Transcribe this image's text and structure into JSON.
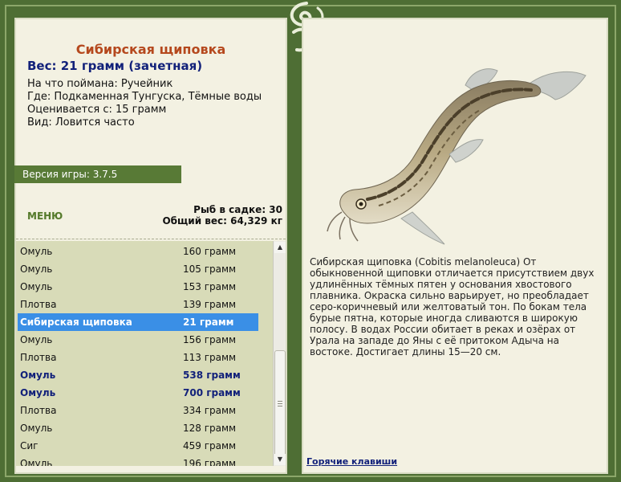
{
  "fish": {
    "name": "Сибирская щиповка",
    "weight_line": "Вес: 21 грамм (зачетная)",
    "bait_line": "На что поймана: Ручейник",
    "place_line": "Где: Подкаменная Тунгуска, Тёмные воды",
    "rating_line": "Оценивается с: 15 грамм",
    "kind_line": "Вид: Ловится часто",
    "description": "Сибирская щиповка (Cobitis melanoleuca) От обыкновенной щиповки отличается присутствием двух удлинённых тёмных пятен у основания хвостового плавника. Окраска сильно варьирует, но преобладает серо-коричневый или желтоватый тон. По бокам тела бурые пятна, которые иногда сливаются в широкую полосу. В водах России обитает в реках и озёрах от Урала на западе до Яны с её притоком Адыча на востоке. Достигает длины 15—20 см."
  },
  "version": "Версия игры: 3.7.5",
  "menu_label": "меню",
  "stats": {
    "fish_in_keepnet": "Рыб в садке: 30",
    "total_weight": "Общий вес: 64,329 кг"
  },
  "catch_list": [
    {
      "name": "Омуль",
      "weight": "160 грамм",
      "state": "normal"
    },
    {
      "name": "Омуль",
      "weight": "105 грамм",
      "state": "normal"
    },
    {
      "name": "Омуль",
      "weight": "153 грамм",
      "state": "normal"
    },
    {
      "name": "Плотва",
      "weight": "139 грамм",
      "state": "normal"
    },
    {
      "name": "Сибирская щиповка",
      "weight": "21 грамм",
      "state": "selected"
    },
    {
      "name": "Омуль",
      "weight": "156 грамм",
      "state": "normal"
    },
    {
      "name": "Плотва",
      "weight": "113 грамм",
      "state": "normal"
    },
    {
      "name": "Омуль",
      "weight": "538 грамм",
      "state": "trophy"
    },
    {
      "name": "Омуль",
      "weight": "700 грамм",
      "state": "trophy"
    },
    {
      "name": "Плотва",
      "weight": "334 грамм",
      "state": "normal"
    },
    {
      "name": "Омуль",
      "weight": "128 грамм",
      "state": "normal"
    },
    {
      "name": "Сиг",
      "weight": "459 грамм",
      "state": "normal"
    },
    {
      "name": "Омуль",
      "weight": "196 грамм",
      "state": "normal"
    }
  ],
  "hotkeys_label": "Горячие клавиши",
  "colors": {
    "background_green": "#4e6e34",
    "panel_cream": "#f3f1e2",
    "title_orange": "#b5481d",
    "navy_text": "#12217a",
    "selection_blue": "#3a8fe6",
    "list_bg": "#d8dbb8"
  }
}
